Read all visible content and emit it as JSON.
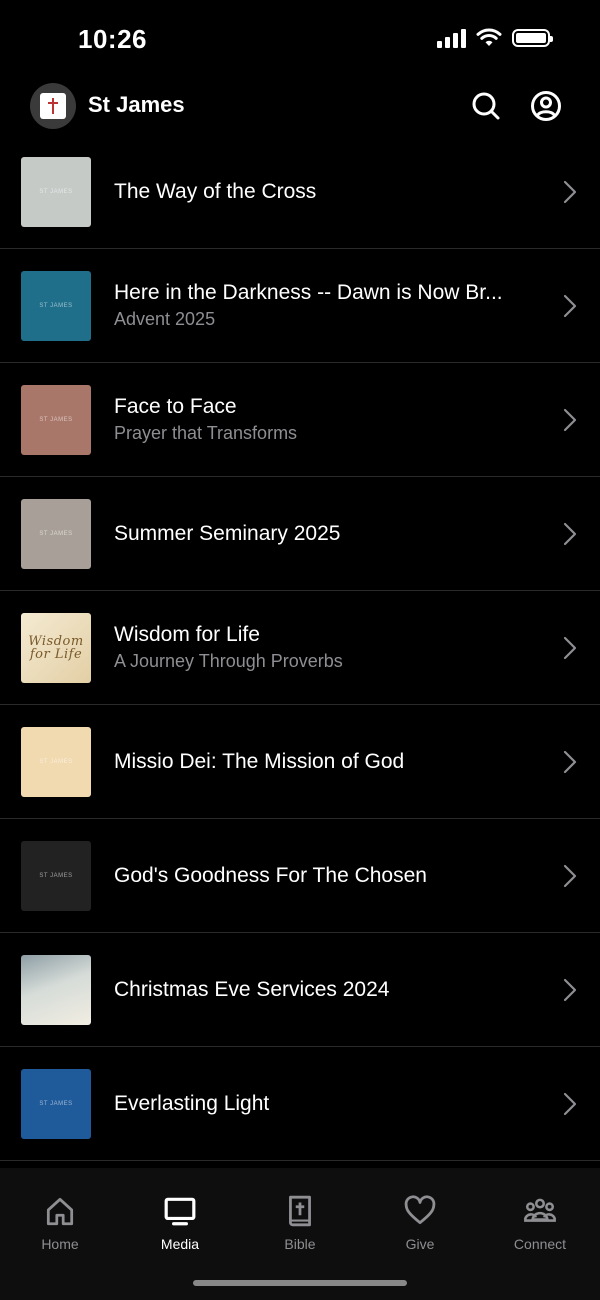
{
  "status": {
    "time": "10:26"
  },
  "header": {
    "title": "St James"
  },
  "items": [
    {
      "title": "The Way of the Cross",
      "subtitle": "",
      "thumb_color": "#c5cac7",
      "thumb_mark": "ST JAMES"
    },
    {
      "title": "Here in the Darkness -- Dawn is Now Br...",
      "subtitle": "Advent 2025",
      "thumb_color": "#1f6f8b",
      "thumb_mark": "ST JAMES"
    },
    {
      "title": "Face to Face",
      "subtitle": "Prayer that Transforms",
      "thumb_color": "#a9776a",
      "thumb_mark": "ST JAMES"
    },
    {
      "title": "Summer Seminary 2025",
      "subtitle": "",
      "thumb_color": "#a8a098",
      "thumb_mark": "ST JAMES"
    },
    {
      "title": "Wisdom for Life",
      "subtitle": "A Journey Through Proverbs",
      "thumb_color": "#efe3c8",
      "thumb_mark": "Wisdom for Life"
    },
    {
      "title": "Missio Dei: The Mission of God",
      "subtitle": "",
      "thumb_color": "#f1d9b0",
      "thumb_mark": "ST JAMES"
    },
    {
      "title": "God's Goodness For The Chosen",
      "subtitle": "",
      "thumb_color": "#222222",
      "thumb_mark": "ST JAMES"
    },
    {
      "title": "Christmas Eve Services 2024",
      "subtitle": "",
      "thumb_color": "#b9c4c6",
      "thumb_mark": ""
    },
    {
      "title": "Everlasting Light",
      "subtitle": "",
      "thumb_color": "#1f5a9a",
      "thumb_mark": "ST JAMES"
    }
  ],
  "tabs": [
    {
      "label": "Home",
      "icon": "home-icon",
      "active": false
    },
    {
      "label": "Media",
      "icon": "tv-icon",
      "active": true
    },
    {
      "label": "Bible",
      "icon": "bible-icon",
      "active": false
    },
    {
      "label": "Give",
      "icon": "heart-icon",
      "active": false
    },
    {
      "label": "Connect",
      "icon": "people-icon",
      "active": false
    }
  ]
}
